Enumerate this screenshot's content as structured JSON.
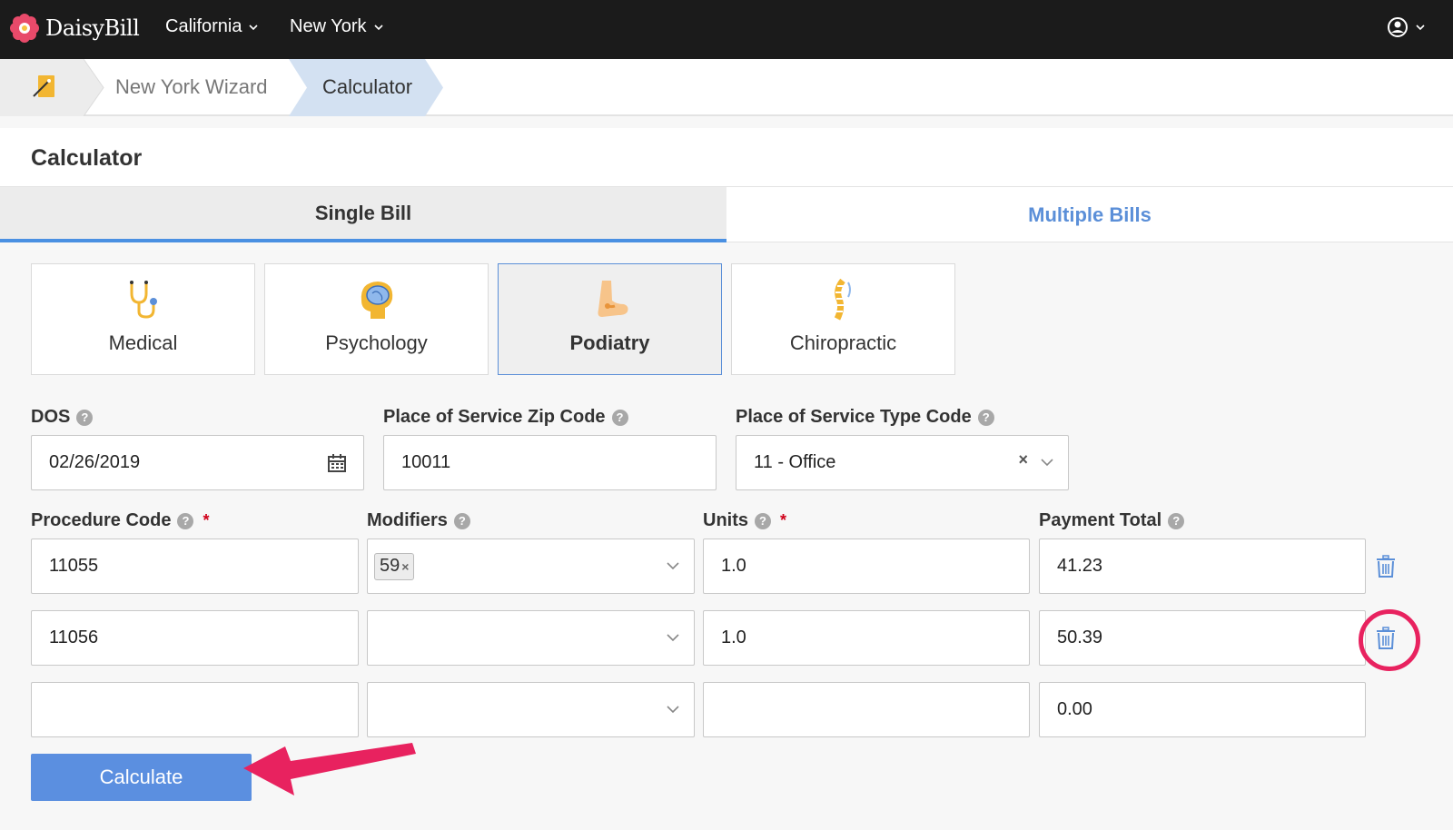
{
  "topbar": {
    "brand": "DaisyBill",
    "nav": [
      {
        "label": "California"
      },
      {
        "label": "New York"
      }
    ]
  },
  "breadcrumb": {
    "items": [
      {
        "label": "New York Wizard"
      },
      {
        "label": "Calculator"
      }
    ]
  },
  "page": {
    "title": "Calculator"
  },
  "tabs": [
    {
      "label": "Single Bill",
      "active": true
    },
    {
      "label": "Multiple Bills",
      "active": false
    }
  ],
  "specialties": [
    {
      "label": "Medical",
      "icon": "stethoscope-icon"
    },
    {
      "label": "Psychology",
      "icon": "brain-icon"
    },
    {
      "label": "Podiatry",
      "icon": "foot-icon",
      "active": true
    },
    {
      "label": "Chiropractic",
      "icon": "spine-icon"
    }
  ],
  "form": {
    "dos": {
      "label": "DOS",
      "value": "02/26/2019"
    },
    "zip": {
      "label": "Place of Service Zip Code",
      "value": "10011"
    },
    "pos_type": {
      "label": "Place of Service Type Code",
      "value": "11 - Office"
    },
    "headers": {
      "procedure": "Procedure Code",
      "modifiers": "Modifiers",
      "units": "Units",
      "payment": "Payment Total",
      "required_mark": "*"
    },
    "rows": [
      {
        "procedure": "11055",
        "modifiers": [
          "59"
        ],
        "units": "1.0",
        "payment": "41.23"
      },
      {
        "procedure": "11056",
        "modifiers": [],
        "units": "1.0",
        "payment": "50.39"
      },
      {
        "procedure": "",
        "modifiers": [],
        "units": "",
        "payment": "0.00"
      }
    ]
  },
  "actions": {
    "calculate": "Calculate"
  },
  "colors": {
    "accent": "#5b8fe0",
    "highlight": "#e8225f",
    "topbar": "#1b1b1b"
  }
}
